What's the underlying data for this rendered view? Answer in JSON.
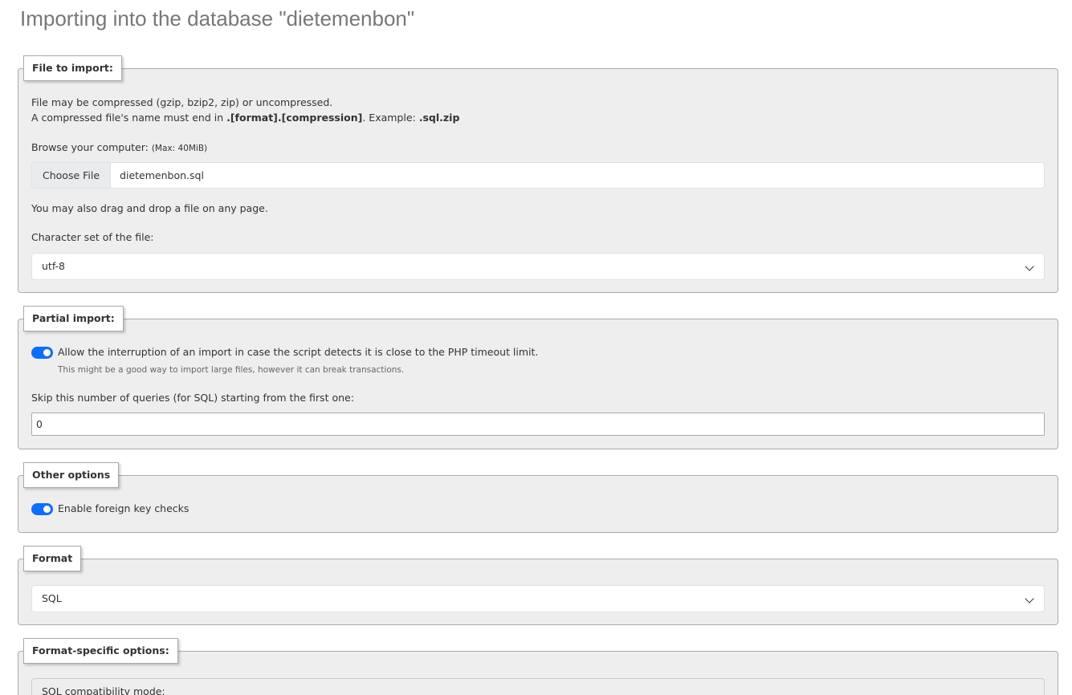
{
  "page": {
    "title": "Importing into the database \"dietemenbon\""
  },
  "file_import": {
    "legend": "File to import:",
    "line1": "File may be compressed (gzip, bzip2, zip) or uncompressed.",
    "line2_prefix": "A compressed file's name must end in ",
    "line2_bold": ".[format].[compression]",
    "line2_mid": ". Example: ",
    "line2_example": ".sql.zip",
    "browse_label": "Browse your computer: ",
    "max_size": "(Max: 40MiB)",
    "choose_file_label": "Choose File",
    "file_name": "dietemenbon.sql",
    "drag_drop_note": "You may also drag and drop a file on any page.",
    "charset_label": "Character set of the file:",
    "charset_value": "utf-8"
  },
  "partial_import": {
    "legend": "Partial import:",
    "interrupt_label": "Allow the interruption of an import in case the script detects it is close to the PHP timeout limit.",
    "interrupt_enabled": true,
    "interrupt_hint": "This might be a good way to import large files, however it can break transactions.",
    "skip_label": "Skip this number of queries (for SQL) starting from the first one:",
    "skip_value": "0"
  },
  "other_options": {
    "legend": "Other options",
    "foreign_key_label": "Enable foreign key checks",
    "foreign_key_enabled": true
  },
  "format": {
    "legend": "Format",
    "value": "SQL"
  },
  "format_specific": {
    "legend": "Format-specific options:",
    "compat_label": "SQL compatibility mode:"
  },
  "colors": {
    "accent": "#0d6efd",
    "panel_bg": "#eeeeee",
    "border": "#aaaaaa"
  }
}
